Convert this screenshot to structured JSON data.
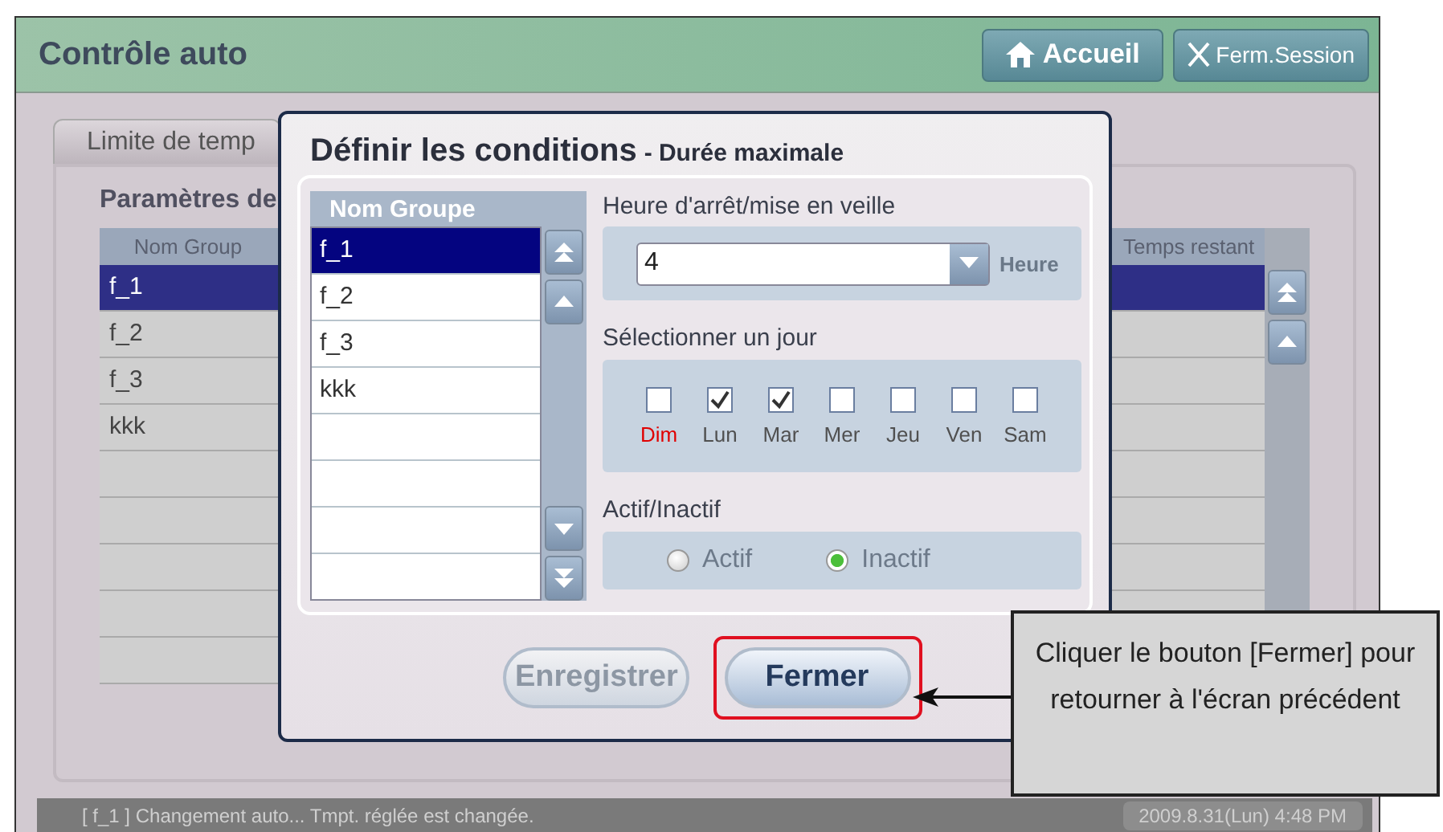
{
  "header": {
    "title": "Contrôle auto",
    "buttons": [
      {
        "label": "Accueil",
        "kind": "home"
      },
      {
        "label": "Ferm.Session",
        "kind": "close"
      }
    ]
  },
  "background": {
    "tab": {
      "label": "Limite de temp",
      "selected": true
    },
    "section_title": "Paramètres de",
    "table": {
      "columns": [
        "Nom Group",
        "Temps restant"
      ],
      "rows": [
        {
          "name": "f_1",
          "selected": true
        },
        {
          "name": "f_2",
          "selected": false
        },
        {
          "name": "f_3",
          "selected": false
        },
        {
          "name": "kkk",
          "selected": false
        }
      ]
    }
  },
  "dialog": {
    "title": "Définir les conditions",
    "subtitle": "- Durée maximale",
    "group_list": {
      "header": "Nom Groupe",
      "items": [
        {
          "label": "f_1",
          "selected": true
        },
        {
          "label": "f_2",
          "selected": false
        },
        {
          "label": "f_3",
          "selected": false
        },
        {
          "label": "kkk",
          "selected": false
        }
      ]
    },
    "stop_time": {
      "label": "Heure d'arrêt/mise en veille",
      "value": "4",
      "unit": "Heure"
    },
    "day_select": {
      "label": "Sélectionner un jour",
      "days": [
        {
          "label": "Dim",
          "checked": false,
          "color": "#e00000"
        },
        {
          "label": "Lun",
          "checked": true,
          "color": "#505050"
        },
        {
          "label": "Mar",
          "checked": true,
          "color": "#505050"
        },
        {
          "label": "Mer",
          "checked": false,
          "color": "#505050"
        },
        {
          "label": "Jeu",
          "checked": false,
          "color": "#505050"
        },
        {
          "label": "Ven",
          "checked": false,
          "color": "#505050"
        },
        {
          "label": "Sam",
          "checked": false,
          "color": "#505050"
        }
      ]
    },
    "active": {
      "label": "Actif/Inactif",
      "options": [
        {
          "label": "Actif",
          "selected": false
        },
        {
          "label": "Inactif",
          "selected": true
        }
      ]
    },
    "buttons": [
      {
        "label": "Enregistrer",
        "disabled": true,
        "highlighted": false
      },
      {
        "label": "Fermer",
        "disabled": false,
        "highlighted": true
      }
    ]
  },
  "annotation": {
    "text": "Cliquer le bouton [Fermer] pour retourner à l'écran précédent"
  },
  "status_bar": {
    "message": "[ f_1 ] Changement auto... Tmpt. réglée est changée.",
    "datetime": "2009.8.31(Lun)  4:48 PM"
  }
}
